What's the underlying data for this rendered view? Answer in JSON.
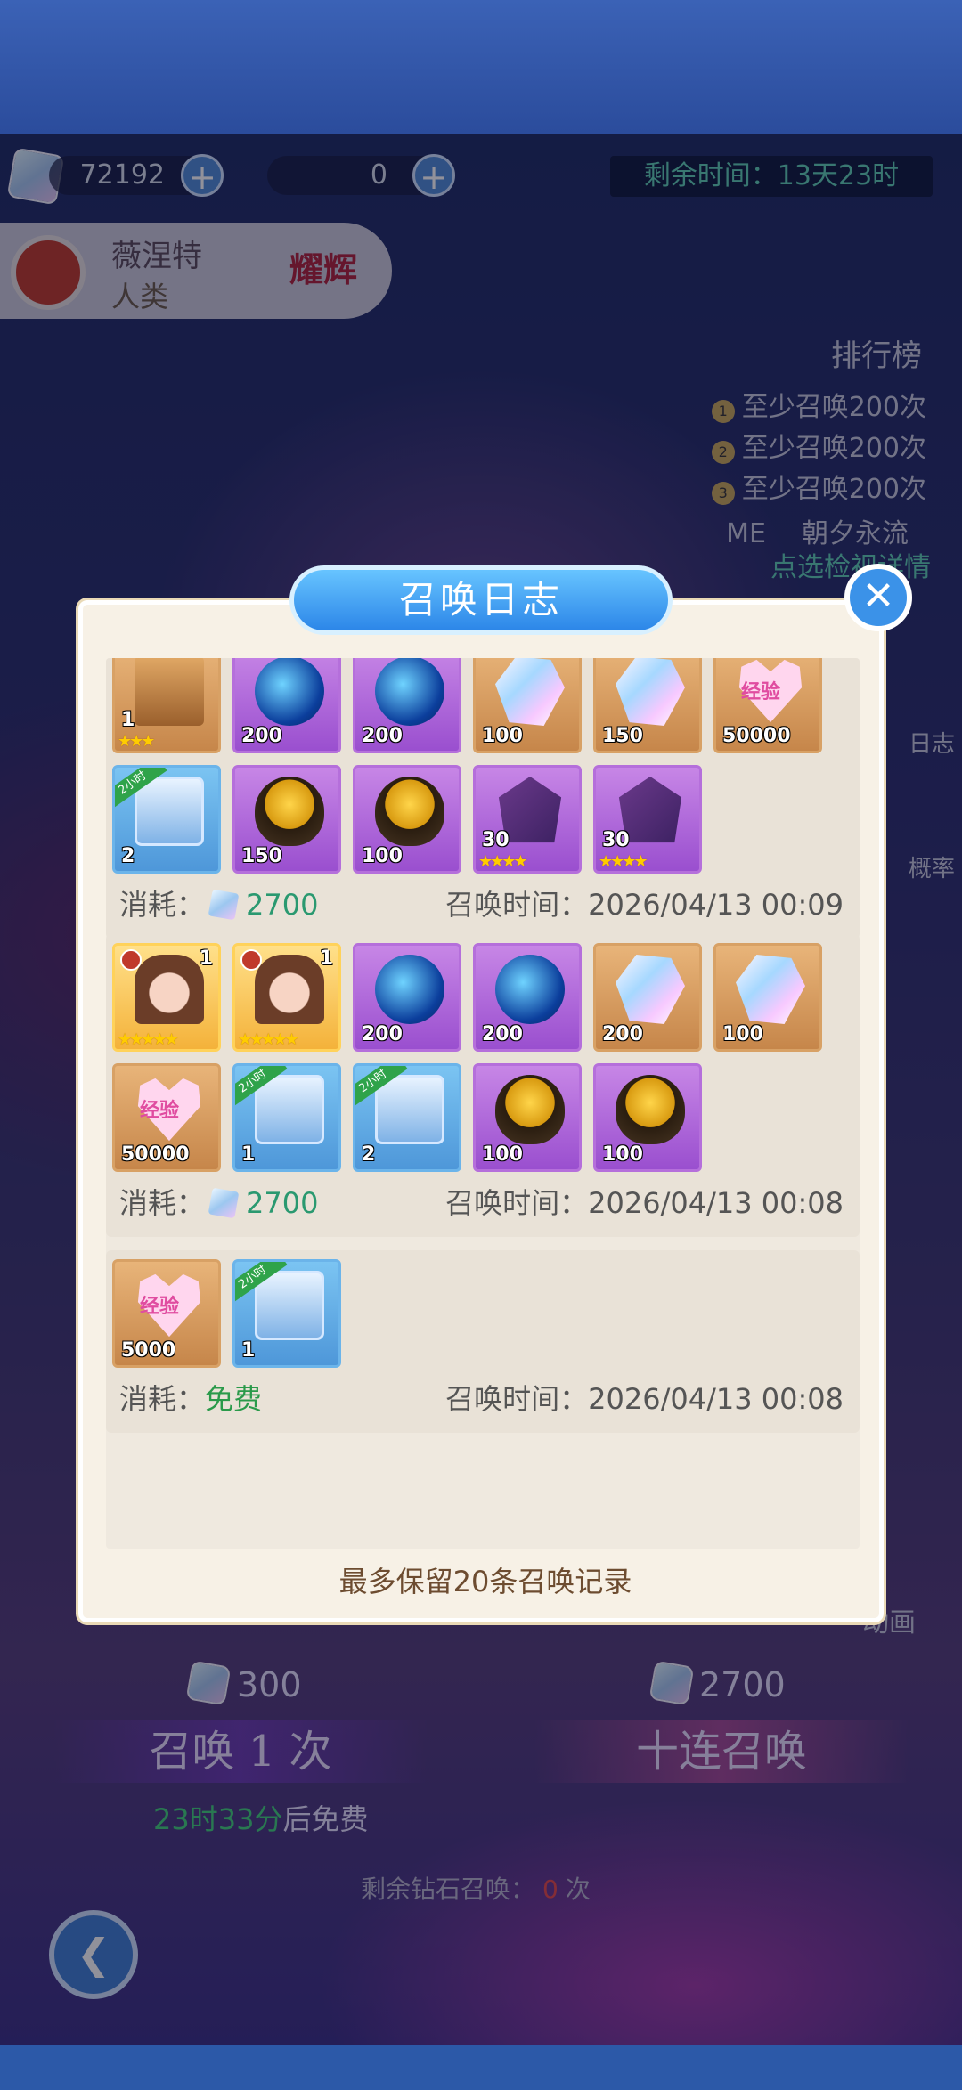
{
  "top_resources": {
    "diamonds": "72192",
    "tickets": "0",
    "plus": "+"
  },
  "timer": "剩余时间：13天23时",
  "character": {
    "name": "薇涅特",
    "race": "人类",
    "badge": "耀辉"
  },
  "leaderboard": {
    "title": "排行榜",
    "rows": [
      "至少召唤200次",
      "至少召唤200次",
      "至少召唤200次"
    ],
    "rank_nums": [
      "1",
      "2",
      "3"
    ],
    "me_label": "ME",
    "me_name": "朝夕永流",
    "me_hint": "点选检视详情"
  },
  "side": {
    "log": "日志",
    "rate": "概率",
    "anim": "动画"
  },
  "summon": {
    "single_cost": "300",
    "ten_cost": "2700",
    "single_label": "召唤 1 次",
    "ten_label": "十连召唤",
    "free_time": "23时33分",
    "free_suffix": "后免费",
    "remaining_label": "剩余钻石召唤：",
    "remaining_count": "0",
    "remaining_suffix": "次"
  },
  "modal": {
    "title": "召唤日志",
    "close": "✕",
    "cost_label": "消耗：",
    "time_label": "召唤时间：",
    "footer_note": "最多保留20条召唤记录",
    "records": [
      {
        "cost": "2700",
        "time": "2026/04/13 00:09",
        "items": [
          {
            "kind": "box",
            "bg": "brown",
            "qty": "1",
            "stars": "★★★"
          },
          {
            "kind": "orb",
            "bg": "purple",
            "qty": "200"
          },
          {
            "kind": "orb",
            "bg": "purple",
            "qty": "200"
          },
          {
            "kind": "gem",
            "bg": "brown",
            "qty": "100"
          },
          {
            "kind": "gem",
            "bg": "brown",
            "qty": "150"
          },
          {
            "kind": "heart",
            "bg": "brown",
            "qty": "50000",
            "label": "经验"
          },
          {
            "kind": "chest",
            "bg": "blue",
            "qty": "2",
            "tag": "2小时"
          },
          {
            "kind": "egg",
            "bg": "purple",
            "qty": "150"
          },
          {
            "kind": "egg",
            "bg": "purple",
            "qty": "100"
          },
          {
            "kind": "shard",
            "bg": "purple",
            "qty": "30",
            "stars": "★★★★"
          },
          {
            "kind": "shard",
            "bg": "purple",
            "qty": "30",
            "stars": "★★★★"
          }
        ]
      },
      {
        "cost": "2700",
        "time": "2026/04/13 00:08",
        "items": [
          {
            "kind": "girl",
            "bg": "gold",
            "qty_tr": "1",
            "stars": "★★★★★"
          },
          {
            "kind": "girl",
            "bg": "gold",
            "qty_tr": "1",
            "stars": "★★★★★"
          },
          {
            "kind": "orb",
            "bg": "purple",
            "qty": "200"
          },
          {
            "kind": "orb",
            "bg": "purple",
            "qty": "200"
          },
          {
            "kind": "gem",
            "bg": "brown",
            "qty": "200"
          },
          {
            "kind": "gem",
            "bg": "brown",
            "qty": "100"
          },
          {
            "kind": "heart",
            "bg": "brown",
            "qty": "50000",
            "label": "经验"
          },
          {
            "kind": "chest",
            "bg": "blue",
            "qty": "1",
            "tag": "2小时"
          },
          {
            "kind": "chest",
            "bg": "blue",
            "qty": "2",
            "tag": "2小时"
          },
          {
            "kind": "egg",
            "bg": "purple",
            "qty": "100"
          },
          {
            "kind": "egg",
            "bg": "purple",
            "qty": "100"
          }
        ]
      },
      {
        "cost": "免费",
        "free": true,
        "time": "2026/04/13 00:08",
        "items": [
          {
            "kind": "heart",
            "bg": "brown",
            "qty": "5000",
            "label": "经验"
          },
          {
            "kind": "chest",
            "bg": "blue",
            "qty": "1",
            "tag": "2小时"
          }
        ]
      }
    ]
  }
}
